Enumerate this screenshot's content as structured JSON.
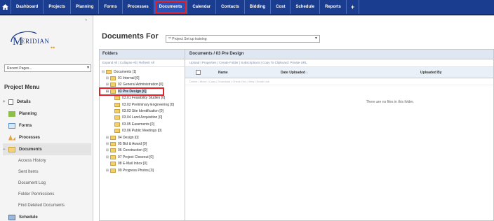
{
  "topnav": {
    "items": [
      "Dashboard",
      "Projects",
      "Planning",
      "Forms",
      "Processes",
      "Documents",
      "Calendar",
      "Contacts",
      "Bidding",
      "Cost",
      "Schedule",
      "Reports"
    ],
    "active_index": 5,
    "plus": "+",
    "home_icon": "home-icon"
  },
  "logo": {
    "text": "MERIDIAN",
    "accent": "#1b3d8f"
  },
  "recent_pages": {
    "value": "Recent Pages..."
  },
  "project_menu": {
    "title": "Project Menu",
    "items": [
      {
        "label": "Details",
        "toggle": "+",
        "icon": "document-icon"
      },
      {
        "label": "Planning",
        "icon": "planning-icon"
      },
      {
        "label": "Forms",
        "icon": "forms-icon"
      },
      {
        "label": "Processes",
        "icon": "processes-icon"
      },
      {
        "label": "Documents",
        "toggle": "−",
        "icon": "folder-icon"
      },
      {
        "label": "Access History"
      },
      {
        "label": "Sent Items"
      },
      {
        "label": "Document Log"
      },
      {
        "label": "Folder Permissions"
      },
      {
        "label": "Find Deleted Documents"
      },
      {
        "label": "Schedule",
        "icon": "schedule-icon"
      }
    ]
  },
  "header": {
    "title": "Documents For",
    "project": "** Project Set up training"
  },
  "folders": {
    "title": "Folders",
    "links": "Expand All | Collapse All | Refresh All",
    "tree": [
      {
        "label": "Documents [1]",
        "expander": "⊟"
      },
      {
        "label": "01 Internal [0]",
        "expander": "⊞"
      },
      {
        "label": "02 General Administration [0]",
        "expander": "⊞"
      },
      {
        "label": "03 Pre Design [0]",
        "expander": "⊟"
      },
      {
        "label": "03.01 Feasibility Studies [0]"
      },
      {
        "label": "03.02 Preliminary Engineering [0]"
      },
      {
        "label": "03.03 Site Identification [0]"
      },
      {
        "label": "03.04 Land Acquisition [0]"
      },
      {
        "label": "03.05 Easements [0]"
      },
      {
        "label": "03.06 Public Meetings [0]"
      },
      {
        "label": "04 Design [0]",
        "expander": "⊞"
      },
      {
        "label": "05 Bid & Award [0]",
        "expander": "⊞"
      },
      {
        "label": "06 Construction [0]",
        "expander": "⊞"
      },
      {
        "label": "07 Project Closeout [0]",
        "expander": "⊞"
      },
      {
        "label": "08 E-Mail Inbox [0]"
      },
      {
        "label": "09 Progress Photos [0]",
        "expander": "⊞"
      }
    ]
  },
  "documents": {
    "breadcrumb": "Documents / 03 Pre Design",
    "toolbar": "Upload | Properties | Create Folder | Subscriptions | Copy To Clipboard: Private URL",
    "actions": "Delete | Move | Copy | Download | Check Out | View | Email Link",
    "columns": [
      "Name",
      "Date Uploaded ↓",
      "Uploaded By"
    ],
    "empty_message": "There are no files in this folder."
  },
  "colors": {
    "nav_bg": "#1b3d8f",
    "highlight": "#e0222a",
    "panel_header": "#dfe7f3"
  }
}
